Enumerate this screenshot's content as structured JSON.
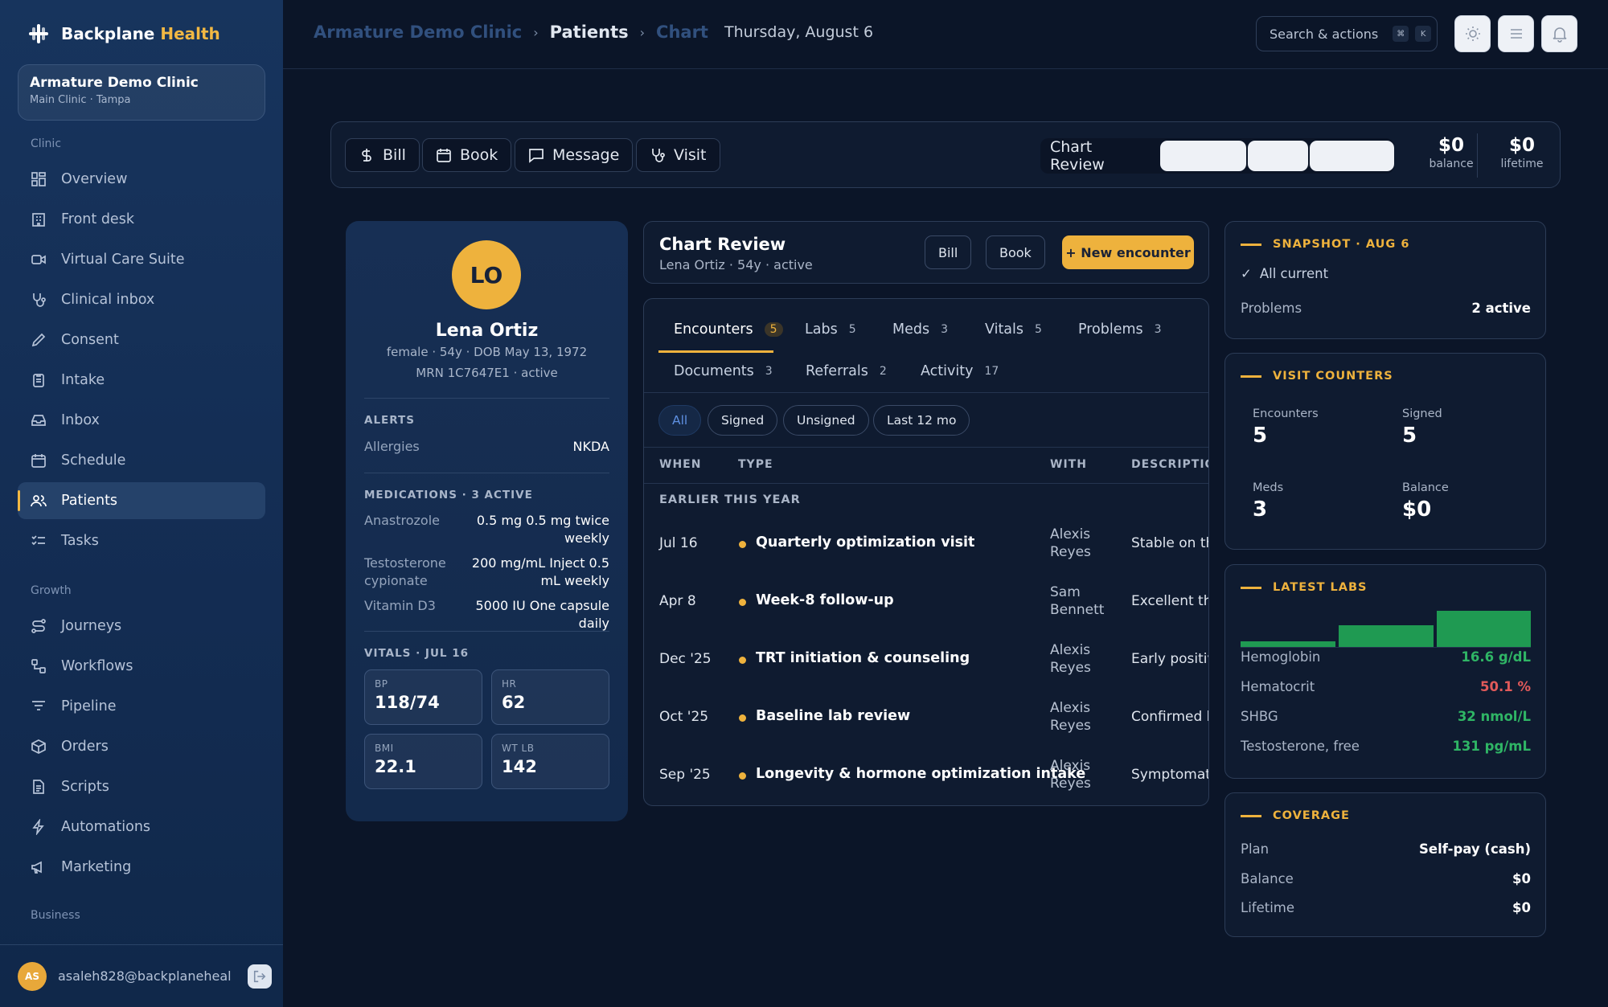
{
  "brand": {
    "name": "Backplane",
    "accent": "Health"
  },
  "clinic": {
    "name": "Armature Demo Clinic",
    "sub": "Main Clinic · Tampa"
  },
  "sidebar": {
    "section_clinic": "Clinic",
    "section_growth": "Growth",
    "section_business": "Business",
    "items": [
      {
        "label": "Overview",
        "icon": "grid-icon"
      },
      {
        "label": "Front desk",
        "icon": "building-icon"
      },
      {
        "label": "Virtual Care Suite",
        "icon": "video-icon"
      },
      {
        "label": "Clinical inbox",
        "icon": "stethoscope-icon"
      },
      {
        "label": "Consent",
        "icon": "pen-icon"
      },
      {
        "label": "Intake",
        "icon": "clipboard-icon"
      },
      {
        "label": "Inbox",
        "icon": "inbox-icon"
      },
      {
        "label": "Schedule",
        "icon": "calendar-icon"
      },
      {
        "label": "Patients",
        "icon": "users-icon",
        "active": true
      },
      {
        "label": "Tasks",
        "icon": "list-check-icon"
      },
      {
        "label": "Journeys",
        "icon": "route-icon"
      },
      {
        "label": "Workflows",
        "icon": "workflow-icon"
      },
      {
        "label": "Pipeline",
        "icon": "filter-icon"
      },
      {
        "label": "Orders",
        "icon": "box-icon"
      },
      {
        "label": "Scripts",
        "icon": "file-text-icon"
      },
      {
        "label": "Automations",
        "icon": "bolt-icon"
      },
      {
        "label": "Marketing",
        "icon": "megaphone-icon"
      }
    ],
    "user": {
      "initials": "AS",
      "email": "asaleh828@backplaneheal"
    }
  },
  "topbar": {
    "crumbs": [
      "Armature Demo Clinic",
      "Patients",
      "Chart"
    ],
    "date": "Thursday, August 6",
    "search_label": "Search & actions",
    "kbd": [
      "⌘",
      "K"
    ]
  },
  "actions": {
    "bill": "Bill",
    "book": "Book",
    "message": "Message",
    "visit": "Visit",
    "chart_review": "Chart Review",
    "balance_value": "$0",
    "balance_label": "balance",
    "lifetime_value": "$0",
    "lifetime_label": "lifetime"
  },
  "patient": {
    "initials": "LO",
    "name": "Lena Ortiz",
    "line1": "female · 54y · DOB May 13, 1972",
    "line2": "MRN 1C7647E1 · active",
    "alerts_h": "ALERTS",
    "allergies_k": "Allergies",
    "allergies_v": "NKDA",
    "meds_h": "MEDICATIONS · 3 ACTIVE",
    "meds": [
      {
        "name": "Anastrozole",
        "dose": "0.5 mg 0.5 mg twice weekly"
      },
      {
        "name": "Testosterone cypionate",
        "dose": "200 mg/mL Inject 0.5 mL weekly"
      },
      {
        "name": "Vitamin D3",
        "dose": "5000 IU One capsule daily"
      }
    ],
    "vitals_h": "VITALS · JUL 16",
    "vitals": [
      {
        "label": "BP",
        "value": "118/74"
      },
      {
        "label": "HR",
        "value": "62"
      },
      {
        "label": "BMI",
        "value": "22.1"
      },
      {
        "label": "WT LB",
        "value": "142"
      }
    ]
  },
  "chart": {
    "title": "Chart Review",
    "sub": "Lena Ortiz · 54y · active",
    "bill": "Bill",
    "book": "Book",
    "new": "+ New encounter",
    "tabs": [
      {
        "label": "Encounters",
        "count": "5"
      },
      {
        "label": "Labs",
        "count": "5"
      },
      {
        "label": "Meds",
        "count": "3"
      },
      {
        "label": "Vitals",
        "count": "5"
      },
      {
        "label": "Problems",
        "count": "3"
      },
      {
        "label": "Documents",
        "count": "3"
      },
      {
        "label": "Referrals",
        "count": "2"
      },
      {
        "label": "Activity",
        "count": "17"
      }
    ],
    "filters": [
      "All",
      "Signed",
      "Unsigned",
      "Last 12 mo"
    ],
    "columns": [
      "WHEN",
      "TYPE",
      "WITH",
      "DESCRIPTION"
    ],
    "group": "EARLIER THIS YEAR",
    "rows": [
      {
        "when": "Jul 16",
        "type": "Quarterly optimization visit",
        "with": "Alexis Reyes",
        "desc": "Stable on the"
      },
      {
        "when": "Apr 8",
        "type": "Week-8 follow-up",
        "with": "Sam Bennett",
        "desc": "Excellent the"
      },
      {
        "when": "Dec '25",
        "type": "TRT initiation & counseling",
        "with": "Alexis Reyes",
        "desc": "Early positive"
      },
      {
        "when": "Oct '25",
        "type": "Baseline lab review",
        "with": "Alexis Reyes",
        "desc": "Confirmed h"
      },
      {
        "when": "Sep '25",
        "type": "Longevity & hormone optimization intake",
        "with": "Alexis Reyes",
        "desc": "Symptomati"
      }
    ]
  },
  "snapshot": {
    "title": "SNAPSHOT · AUG 6",
    "status": "All current",
    "problems_k": "Problems",
    "problems_v": "2 active"
  },
  "counters": {
    "title": "VISIT COUNTERS",
    "items": [
      {
        "label": "Encounters",
        "value": "5"
      },
      {
        "label": "Signed",
        "value": "5"
      },
      {
        "label": "Meds",
        "value": "3"
      },
      {
        "label": "Balance",
        "value": "$0"
      }
    ]
  },
  "labs": {
    "title": "LATEST LABS",
    "items": [
      {
        "name": "Hemoglobin",
        "value": "16.6 g/dL",
        "color": "#2fb565"
      },
      {
        "name": "Hematocrit",
        "value": "50.1 %",
        "color": "#e25a5a"
      },
      {
        "name": "SHBG",
        "value": "32 nmol/L",
        "color": "#2fb565"
      },
      {
        "name": "Testosterone, free",
        "value": "131 pg/mL",
        "color": "#2fb565"
      }
    ]
  },
  "coverage": {
    "title": "COVERAGE",
    "items": [
      {
        "k": "Plan",
        "v": "Self-pay (cash)"
      },
      {
        "k": "Balance",
        "v": "$0"
      },
      {
        "k": "Lifetime",
        "v": "$0"
      }
    ]
  },
  "colors": {
    "accent": "#eeb23d",
    "good": "#2fb565",
    "bad": "#e25a5a",
    "bg": "#0b1528"
  }
}
